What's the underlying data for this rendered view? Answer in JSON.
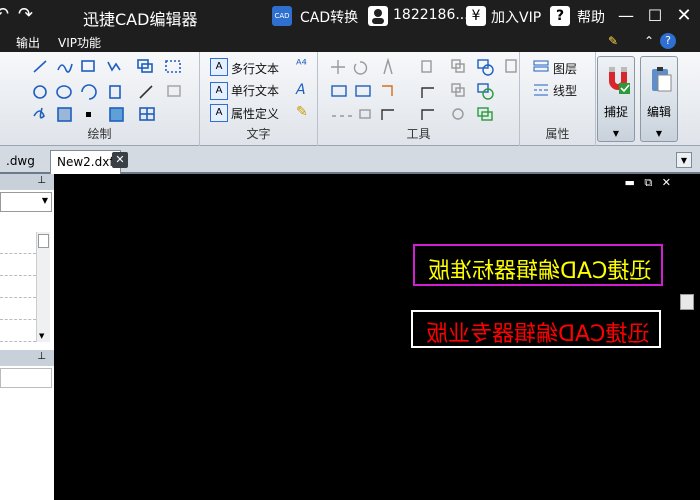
{
  "titlebar": {
    "app_title": "迅捷CAD编辑器",
    "convert_label": "CAD转换",
    "user_label": "1822186...",
    "vip_label": "加入VIP",
    "help_label": "帮助"
  },
  "menu": {
    "export_label": "输出",
    "vip_label": "VIP功能"
  },
  "ribbon": {
    "draw_group": "绘制",
    "text_group": "文字",
    "tools_group": "工具",
    "props_group": "属性",
    "multiline_text": "多行文本",
    "single_text": "单行文本",
    "attr_def": "属性定义",
    "layer_label": "图层",
    "linetype_label": "线型",
    "snap_label": "捕捉",
    "edit_label": "编辑"
  },
  "tabs": [
    {
      "label": ".dwg"
    },
    {
      "label": "New2.dxf"
    }
  ],
  "canvas": {
    "text_yellow": "迅捷CAD编辑器标准版",
    "text_red": "迅捷CAD编辑器专业版"
  },
  "colors": {
    "titlebar_bg": "#1e1e1e",
    "canvas_bg": "#000000",
    "text_yellow": "#ffff00",
    "text_red": "#ff0000",
    "box_magenta": "#d21ed2",
    "box_white": "#ffffff"
  }
}
